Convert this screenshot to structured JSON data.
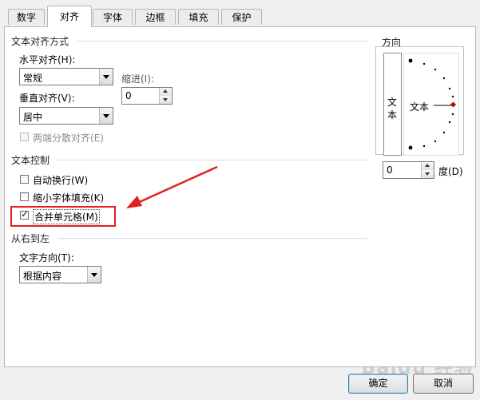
{
  "tabs": [
    {
      "label": "数字",
      "active": false
    },
    {
      "label": "对齐",
      "active": true
    },
    {
      "label": "字体",
      "active": false
    },
    {
      "label": "边框",
      "active": false
    },
    {
      "label": "填充",
      "active": false
    },
    {
      "label": "保护",
      "active": false
    }
  ],
  "alignment": {
    "section_title": "文本对齐方式",
    "horizontal_label": "水平对齐(H):",
    "horizontal_value": "常规",
    "indent_label": "缩进(I):",
    "indent_value": "0",
    "vertical_label": "垂直对齐(V):",
    "vertical_value": "居中",
    "justify_distributed_label": "两端分散对齐(E)"
  },
  "text_control": {
    "section_title": "文本控制",
    "wrap_text_label": "自动换行(W)",
    "wrap_text_checked": false,
    "shrink_to_fit_label": "缩小字体填充(K)",
    "shrink_to_fit_checked": false,
    "merge_cells_label": "合并单元格(M)",
    "merge_cells_checked": true
  },
  "rtl": {
    "section_title": "从右到左",
    "direction_label": "文字方向(T):",
    "direction_value": "根据内容"
  },
  "orientation": {
    "section_title": "方向",
    "vertical_text": [
      "文",
      "本"
    ],
    "dial_text": "文本",
    "degree_value": "0",
    "degree_label": "度(D)"
  },
  "buttons": {
    "ok_label": "确定",
    "cancel_label": "取消"
  },
  "watermark": "Baidu 经验",
  "colors": {
    "highlight": "#e02020",
    "dial_pointer": "#c00000"
  }
}
